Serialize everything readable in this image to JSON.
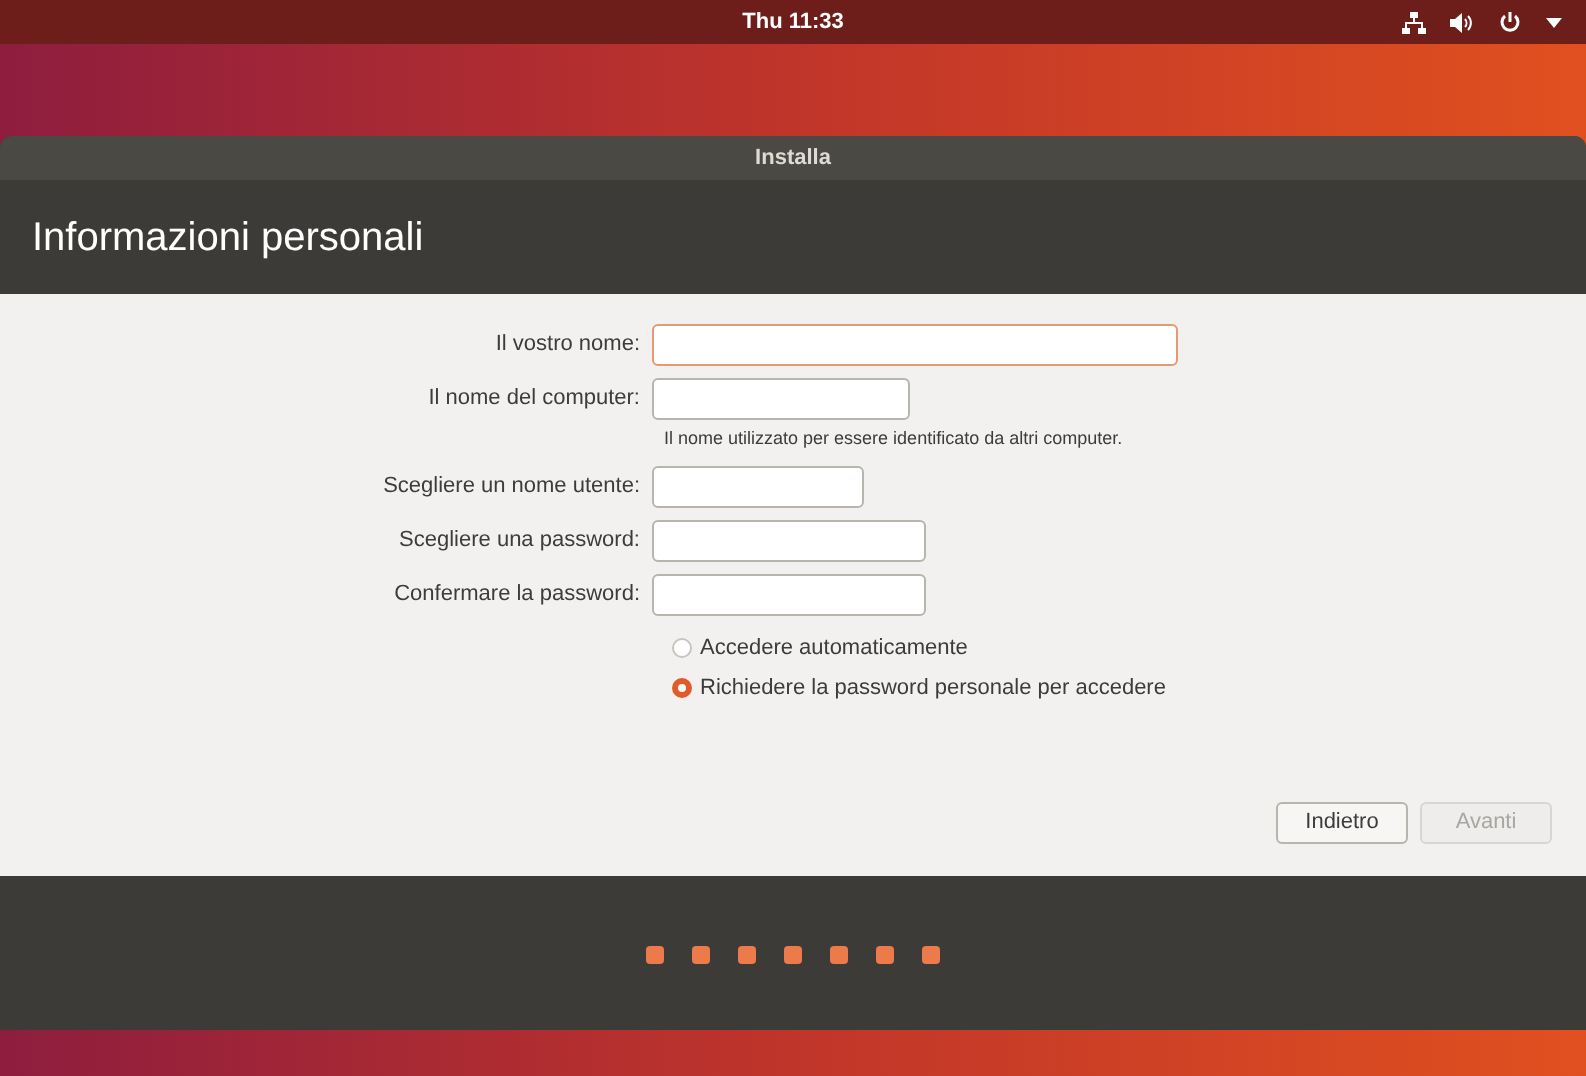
{
  "top_bar": {
    "clock": "Thu 11:33"
  },
  "window": {
    "title": "Installa",
    "heading": "Informazioni personali"
  },
  "fields": [
    {
      "label": "Il vostro nome:",
      "focused": true
    },
    {
      "label": "Il nome del computer:",
      "focused": false,
      "hint": "Il nome utilizzato per essere identificato da altri computer."
    },
    {
      "label": "Scegliere un nome utente:",
      "focused": false
    },
    {
      "label": "Scegliere una password:",
      "focused": false
    },
    {
      "label": "Confermare la password:",
      "focused": false
    }
  ],
  "login_options": [
    {
      "label": "Accedere automaticamente",
      "selected": false
    },
    {
      "label": "Richiedere la password personale per accedere",
      "selected": true
    }
  ],
  "buttons": [
    {
      "label": "Indietro",
      "disabled": false
    },
    {
      "label": "Avanti",
      "disabled": true
    }
  ],
  "progress_dots": [
    {
      "done": true
    },
    {
      "done": true
    },
    {
      "done": true
    },
    {
      "done": true
    },
    {
      "done": true
    },
    {
      "done": true
    },
    {
      "done": true
    }
  ]
}
